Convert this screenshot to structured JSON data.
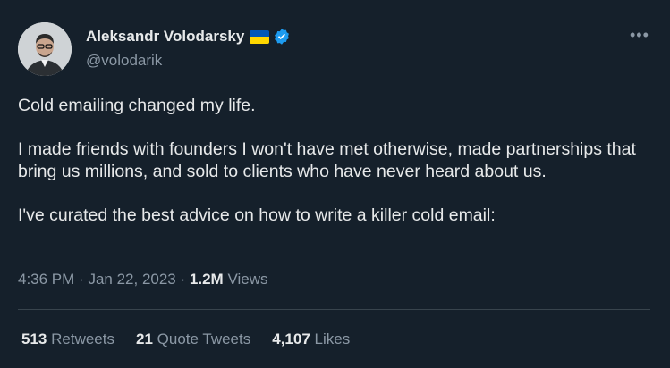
{
  "author": {
    "name": "Aleksandr Volodarsky",
    "handle": "@volodarik",
    "flag_icon": "ukraine-flag-icon",
    "verified_icon": "verified-badge-icon",
    "verified_color": "#1d9bf0"
  },
  "more_label": "•••",
  "tweet": {
    "paragraphs": [
      "Cold emailing changed my life.",
      "I made friends with founders I won't have met otherwise, made partnerships that bring us millions, and sold to clients who have never heard about us.",
      "I've curated the best advice on how to write a killer cold email:"
    ]
  },
  "meta": {
    "time": "4:36 PM",
    "separator": "·",
    "date": "Jan 22, 2023",
    "views_count": "1.2M",
    "views_label": "Views"
  },
  "stats": {
    "retweets_count": "513",
    "retweets_label": "Retweets",
    "quotes_count": "21",
    "quotes_label": "Quote Tweets",
    "likes_count": "4,107",
    "likes_label": "Likes"
  },
  "colors": {
    "background": "#15202b",
    "text": "#e7e9ea",
    "secondary": "#8b98a5",
    "divider": "#38444d"
  }
}
